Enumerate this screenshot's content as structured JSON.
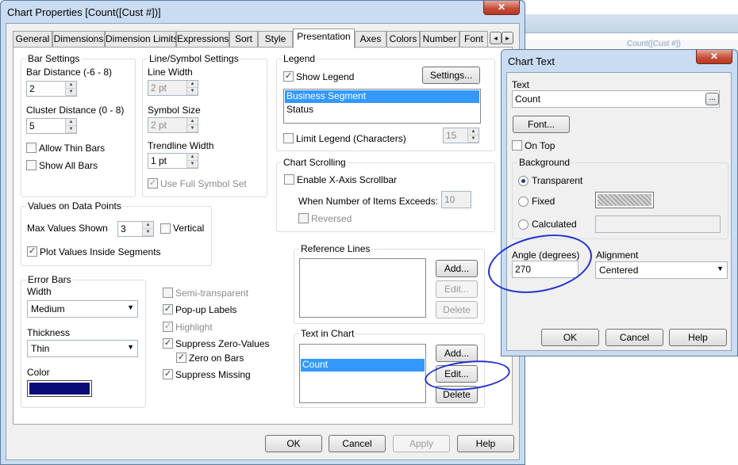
{
  "main_dialog": {
    "title": "Chart Properties [Count([Cust #])]",
    "close_glyph": "✕",
    "tabs": [
      {
        "label": "General"
      },
      {
        "label": "Dimensions"
      },
      {
        "label": "Dimension Limits"
      },
      {
        "label": "Expressions"
      },
      {
        "label": "Sort"
      },
      {
        "label": "Style"
      },
      {
        "label": "Presentation",
        "active": true
      },
      {
        "label": "Axes"
      },
      {
        "label": "Colors"
      },
      {
        "label": "Number"
      },
      {
        "label": "Font"
      }
    ],
    "tab_scroll_left": "◂",
    "tab_scroll_right": "▸",
    "bar_settings": {
      "title": "Bar Settings",
      "bar_distance_label": "Bar Distance (-6 - 8)",
      "bar_distance_value": "2",
      "cluster_distance_label": "Cluster Distance (0 - 8)",
      "cluster_distance_value": "5",
      "allow_thin_bars": "Allow Thin Bars",
      "show_all_bars": "Show All Bars"
    },
    "line_symbol": {
      "title": "Line/Symbol Settings",
      "line_width_label": "Line Width",
      "line_width_value": "2 pt",
      "symbol_size_label": "Symbol Size",
      "symbol_size_value": "2 pt",
      "trendline_width_label": "Trendline Width",
      "trendline_width_value": "1 pt",
      "use_full_symbol_set": "Use Full Symbol Set"
    },
    "values_on_data_points": {
      "title": "Values on Data Points",
      "max_values_label": "Max Values Shown",
      "max_values_value": "3",
      "vertical": "Vertical",
      "plot_inside": "Plot Values Inside Segments"
    },
    "error_bars": {
      "title": "Error Bars",
      "width_label": "Width",
      "width_value": "Medium",
      "thickness_label": "Thickness",
      "thickness_value": "Thin",
      "color_label": "Color",
      "color_swatch": "#0a0a78"
    },
    "misc_options": {
      "semi_transparent": "Semi-transparent",
      "popup_labels": "Pop-up Labels",
      "highlight": "Highlight",
      "suppress_zero": "Suppress Zero-Values",
      "zero_on_bars": "Zero on Bars",
      "suppress_missing": "Suppress Missing"
    },
    "legend": {
      "title": "Legend",
      "show_legend": "Show Legend",
      "settings_button": "Settings...",
      "items": [
        "Business Segment",
        "Status"
      ],
      "limit_legend": "Limit Legend (Characters)",
      "limit_value": "15"
    },
    "chart_scrolling": {
      "title": "Chart Scrolling",
      "enable_scrollbar": "Enable X-Axis Scrollbar",
      "when_exceeds_label": "When Number of Items Exceeds:",
      "when_exceeds_value": "10",
      "reversed": "Reversed"
    },
    "reference_lines": {
      "title": "Reference Lines",
      "add": "Add...",
      "edit": "Edit...",
      "delete": "Delete"
    },
    "text_in_chart": {
      "title": "Text in Chart",
      "items": [
        "Count"
      ],
      "add": "Add...",
      "edit": "Edit...",
      "delete": "Delete"
    },
    "footer": {
      "ok": "OK",
      "cancel": "Cancel",
      "apply": "Apply",
      "help": "Help"
    }
  },
  "chart_text_dialog": {
    "title": "Chart Text",
    "close_glyph": "✕",
    "text_label": "Text",
    "text_value": "Count",
    "browse_button": "...",
    "font_button": "Font...",
    "on_top": "On Top",
    "background": {
      "title": "Background",
      "transparent": "Transparent",
      "fixed": "Fixed",
      "calculated": "Calculated"
    },
    "angle_label": "Angle (degrees)",
    "angle_value": "270",
    "alignment_label": "Alignment",
    "alignment_value": "Centered",
    "ok": "OK",
    "cancel": "Cancel",
    "help": "Help"
  },
  "background_app": {
    "partial_text": "Count([Cust #])"
  },
  "colors": {
    "selection": "#3399ff",
    "annotation": "#2233cc",
    "title_bar": "#c9dcf2",
    "close_button": "#c64a35"
  }
}
